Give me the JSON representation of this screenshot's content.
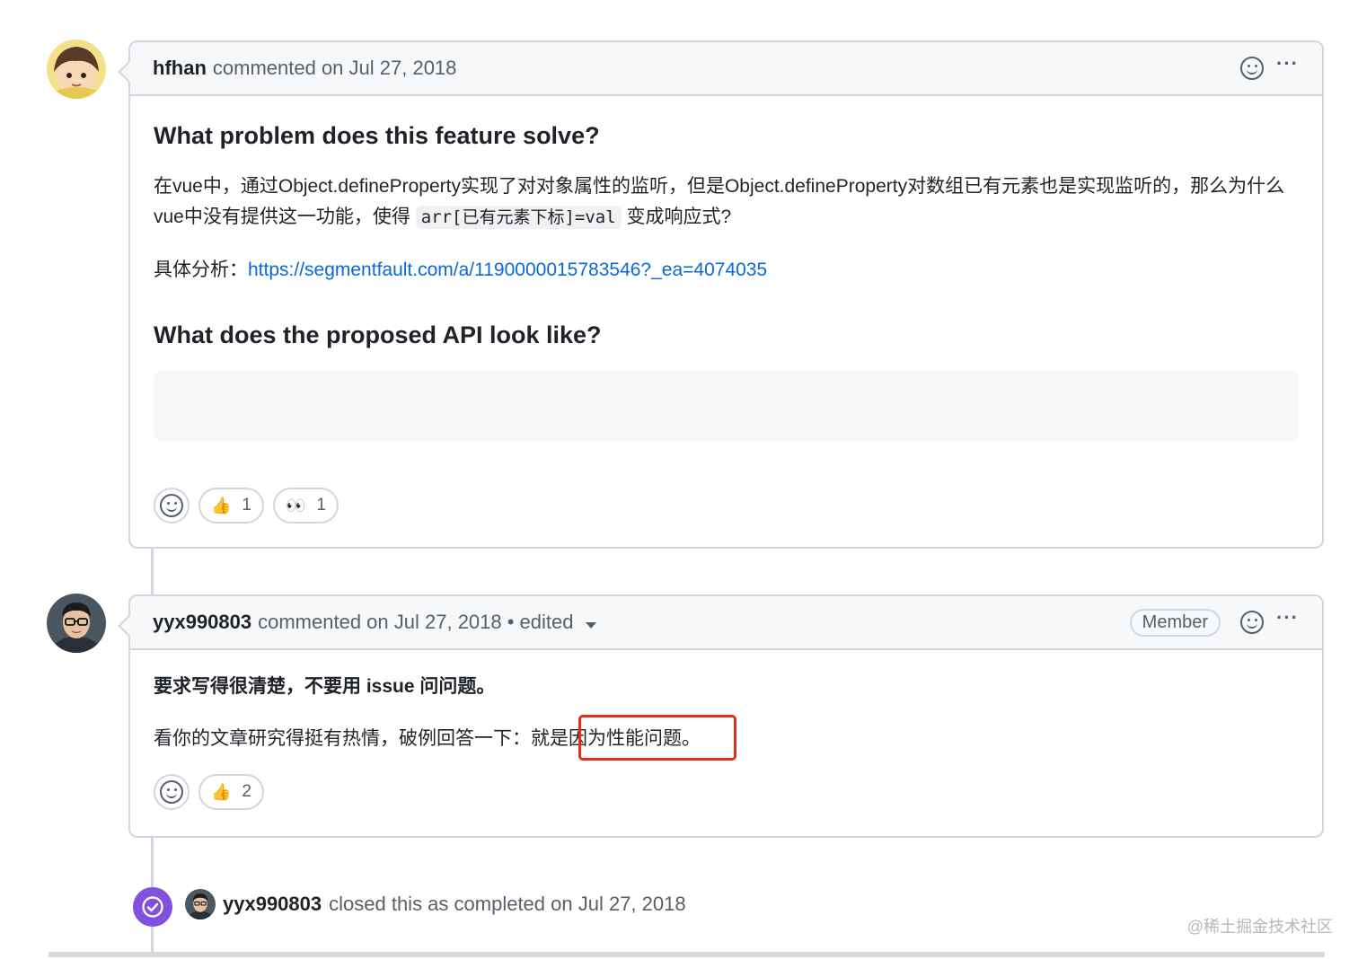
{
  "comment1": {
    "author": "hfhan",
    "meta": "commented on Jul 27, 2018",
    "heading1": "What problem does this feature solve?",
    "para1_a": "在vue中，通过Object.defineProperty实现了对对象属性的监听，但是Object.defineProperty对数组已有元素也是实现监听的，那么为什么vue中没有提供这一功能，使得",
    "para1_code": "arr[已有元素下标]=val",
    "para1_b": "变成响应式?",
    "analysis_label": "具体分析：",
    "analysis_link": "https://segmentfault.com/a/1190000015783546?_ea=4074035",
    "heading2": "What does the proposed API look like?",
    "reactions": [
      {
        "emoji": "👍",
        "count": "1"
      },
      {
        "emoji": "👀",
        "count": "1"
      }
    ]
  },
  "comment2": {
    "author": "yyx990803",
    "meta": "commented on Jul 27, 2018 • edited",
    "badge": "Member",
    "line1": "要求写得很清楚，不要用 issue 问问题。",
    "line2": "看你的文章研究得挺有热情，破例回答一下：就是因为性能问题。",
    "reactions": [
      {
        "emoji": "👍",
        "count": "2"
      }
    ]
  },
  "event": {
    "author": "yyx990803",
    "text": "closed this as completed on Jul 27, 2018"
  },
  "watermark": "@稀土掘金技术社区",
  "icons": {
    "add_reaction": "smiley-icon",
    "more": "kebab-horizontal-icon",
    "closed": "check-circle-icon",
    "dropdown": "triangle-down-icon"
  },
  "colors": {
    "link": "#0969da",
    "closed_badge": "#8250df",
    "highlight": "#e0321b"
  }
}
